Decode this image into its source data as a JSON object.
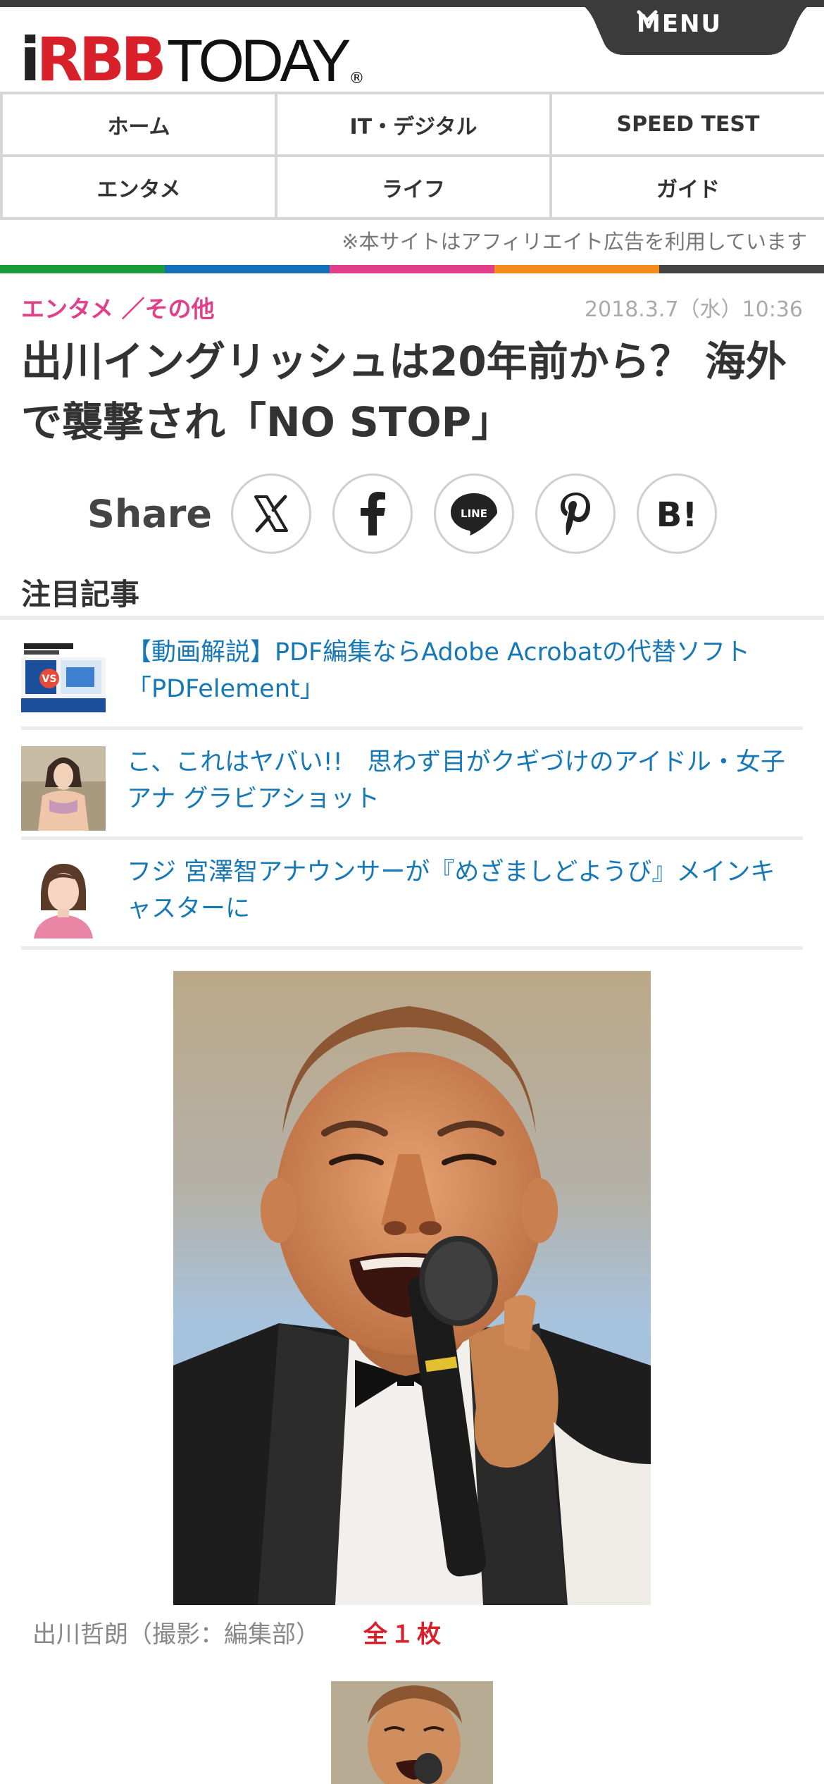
{
  "header": {
    "logo_rbb": "RBB",
    "logo_today": "TODAY",
    "logo_reg": "®",
    "menu_label": "MENU"
  },
  "nav": {
    "items": [
      {
        "label": "ホーム"
      },
      {
        "label": "IT・デジタル"
      },
      {
        "label": "SPEED TEST"
      },
      {
        "label": "エンタメ"
      },
      {
        "label": "ライフ"
      },
      {
        "label": "ガイド"
      }
    ]
  },
  "disclaimer": "※本サイトはアフィリエイト広告を利用しています",
  "category_colors": [
    "#1a9c3e",
    "#1670b8",
    "#e0408a",
    "#f08b1c",
    "#444444"
  ],
  "article": {
    "category": "エンタメ ／その他",
    "date": "2018.3.7（水）10:36",
    "title": "出川イングリッシュは20年前から？ 海外で襲撃され「NO STOP」"
  },
  "share": {
    "label": "Share",
    "buttons": [
      {
        "icon": "x-icon",
        "text": "𝕏"
      },
      {
        "icon": "facebook-icon",
        "text": "f"
      },
      {
        "icon": "line-icon",
        "text": "LINE"
      },
      {
        "icon": "pinterest-icon",
        "text": "P"
      },
      {
        "icon": "hatena-bookmark-icon",
        "text": "B!"
      }
    ]
  },
  "featured": {
    "heading": "注目記事",
    "items": [
      {
        "title": "【動画解説】PDF編集ならAdobe Acrobatの代替ソフト「PDFelement」"
      },
      {
        "title": "こ、これはヤバい!!　思わず目がクギづけのアイドル・女子アナ グラビアショット"
      },
      {
        "title": "フジ 宮澤智アナウンサーが『めざましどようび』メインキャスターに"
      }
    ]
  },
  "photo": {
    "caption": "出川哲朗（撮影：編集部）",
    "count": "全１枚"
  },
  "colors": {
    "accent_red": "#d7202a",
    "category_pink": "#e0408a",
    "link_blue": "#1678b5"
  }
}
